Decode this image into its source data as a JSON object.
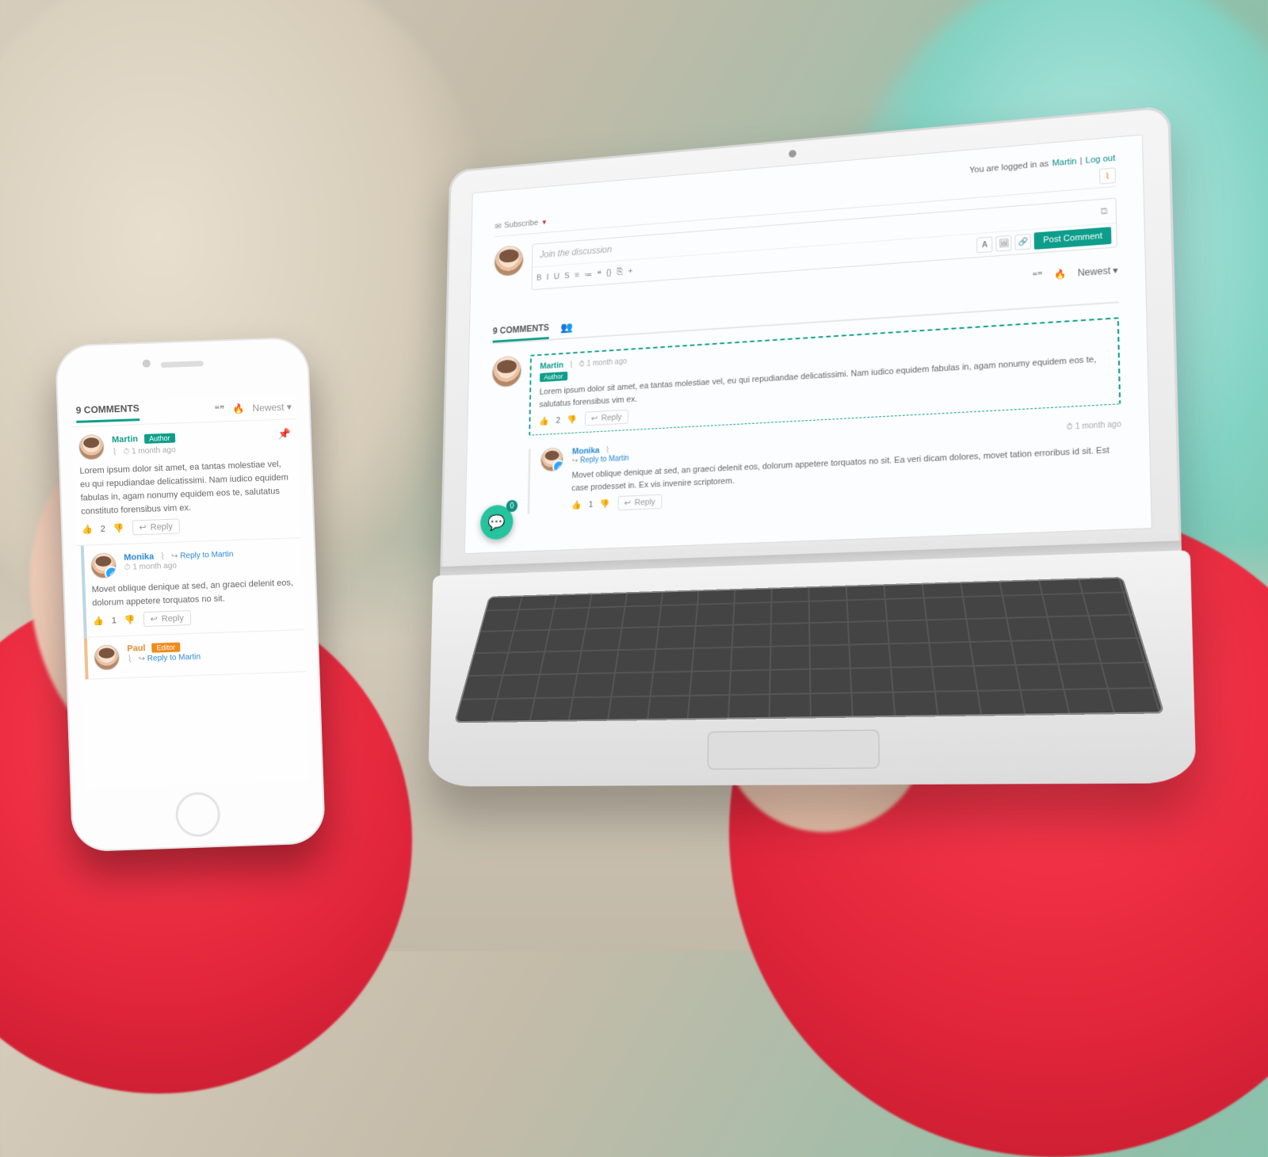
{
  "colors": {
    "accent": "#0d9e8b",
    "hot": "#e05840",
    "link": "#2a8ad4",
    "editor": "#ef8b1d"
  },
  "auth": {
    "prefix": "You are logged in as",
    "user": "Martin",
    "sep": "|",
    "logout": "Log out"
  },
  "subscribe": {
    "icon": "envelope",
    "label": "Subscribe",
    "caret": "▼"
  },
  "compose": {
    "placeholder": "Join the discussion",
    "image_icon": "⧉",
    "format": [
      "B",
      "I",
      "U",
      "S",
      "≡",
      "≔",
      "❝",
      "{}",
      "⎘",
      "+"
    ],
    "attach": [
      "𝐀",
      "🖼",
      "🔗"
    ],
    "post_label": "Post Comment"
  },
  "sort": {
    "quote": "❝❞",
    "hot": "🔥",
    "newest": "Newest",
    "caret": "▾"
  },
  "counter": {
    "count": "9",
    "label": "COMMENTS",
    "user_icon": "👥"
  },
  "fab": {
    "icon": "💬",
    "badge": "0"
  },
  "comments": [
    {
      "user": "Martin",
      "user_color": "teal",
      "role": "Author",
      "time": "1 month ago",
      "vote_up": 2,
      "vote_down": "",
      "text": "Lorem ipsum dolor sit amet, ea tantas molestiae vel, eu qui repudiandae delicatissimi. Nam iudico equidem fabulas in, agam nonumy equidem eos te, salutatus forensibus vim ex.",
      "pinned": true,
      "reply": {
        "user": "Monika",
        "user_color": "blue",
        "verified": true,
        "reply_to": "Martin",
        "time": "1 month ago",
        "vote_up": 1,
        "text": "Movet oblique denique at sed, an graeci delenit eos, dolorum appetere torquatos no sit. Ea veri dicam dolores, movet tation erroribus id sit. Est case prodesset in. Ex vis invenire scriptorem."
      }
    }
  ],
  "phone": {
    "counter": {
      "count": "9",
      "label": "COMMENTS"
    },
    "sort": {
      "quote": "❝❞",
      "hot": "🔥",
      "newest": "Newest",
      "caret": "▾"
    },
    "comments": [
      {
        "user": "Martin",
        "user_color": "teal",
        "role": "Author",
        "time": "1 month ago",
        "vote_up": 2,
        "pinned": true,
        "text": "Lorem ipsum dolor sit amet, ea tantas molestiae vel, eu qui repudiandae delicatissimi. Nam iudico equidem fabulas in, agam nonumy equidem eos te, salutatus constituto forensibus vim ex."
      },
      {
        "user": "Monika",
        "user_color": "blue",
        "verified": true,
        "reply_to": "Martin",
        "time": "1 month ago",
        "vote_up": 1,
        "text": "Movet oblique denique at sed, an graeci delenit eos, dolorum appetere torquatos no sit."
      },
      {
        "user": "Paul",
        "user_color": "orange",
        "role": "Editor",
        "reply_to": "Martin"
      }
    ],
    "reply_label": "Reply",
    "reply_to_label": "Reply to"
  },
  "labels": {
    "reply": "Reply",
    "reply_to": "Reply to"
  }
}
